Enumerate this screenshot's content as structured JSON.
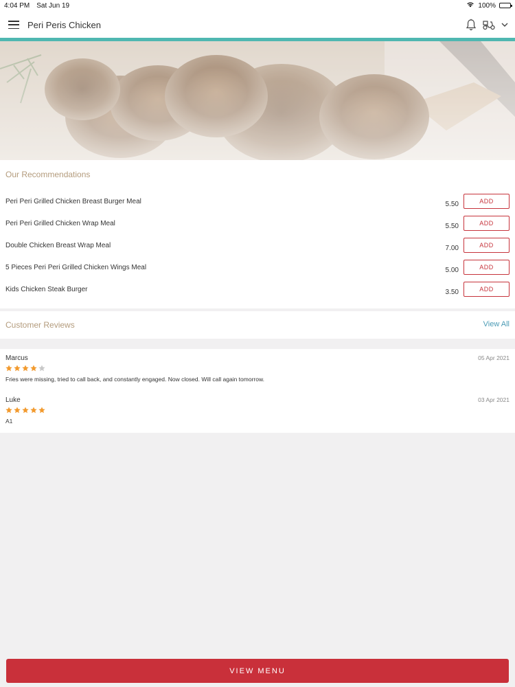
{
  "status_bar": {
    "time": "4:04 PM",
    "date": "Sat Jun 19",
    "battery": "100%"
  },
  "header": {
    "title": "Peri Peris Chicken"
  },
  "colors": {
    "accent": "#4fb7b1",
    "brand_red": "#c9303a",
    "star_filled": "#f29a2e",
    "star_empty": "#c8c8c8",
    "link": "#4b9bb5"
  },
  "recommendations": {
    "title": "Our Recommendations",
    "items": [
      {
        "name": "Peri Peri Grilled Chicken Breast Burger Meal",
        "price": "5.50",
        "button": "ADD"
      },
      {
        "name": "Peri Peri Grilled Chicken Wrap Meal",
        "price": "5.50",
        "button": "ADD"
      },
      {
        "name": "Double Chicken Breast Wrap Meal",
        "price": "7.00",
        "button": "ADD"
      },
      {
        "name": "5 Pieces Peri Peri Grilled Chicken Wings Meal",
        "price": "5.00",
        "button": "ADD"
      },
      {
        "name": "Kids Chicken Steak Burger",
        "price": "3.50",
        "button": "ADD"
      }
    ]
  },
  "reviews": {
    "title": "Customer Reviews",
    "view_all": "View All",
    "items": [
      {
        "name": "Marcus",
        "date": "05 Apr 2021",
        "rating": 4,
        "text": "Fries were missing, tried to call back, and constantly engaged. Now closed. Will call again tomorrow."
      },
      {
        "name": "Luke",
        "date": "03 Apr 2021",
        "rating": 5,
        "text": "A1"
      }
    ]
  },
  "footer": {
    "button": "VIEW MENU"
  }
}
